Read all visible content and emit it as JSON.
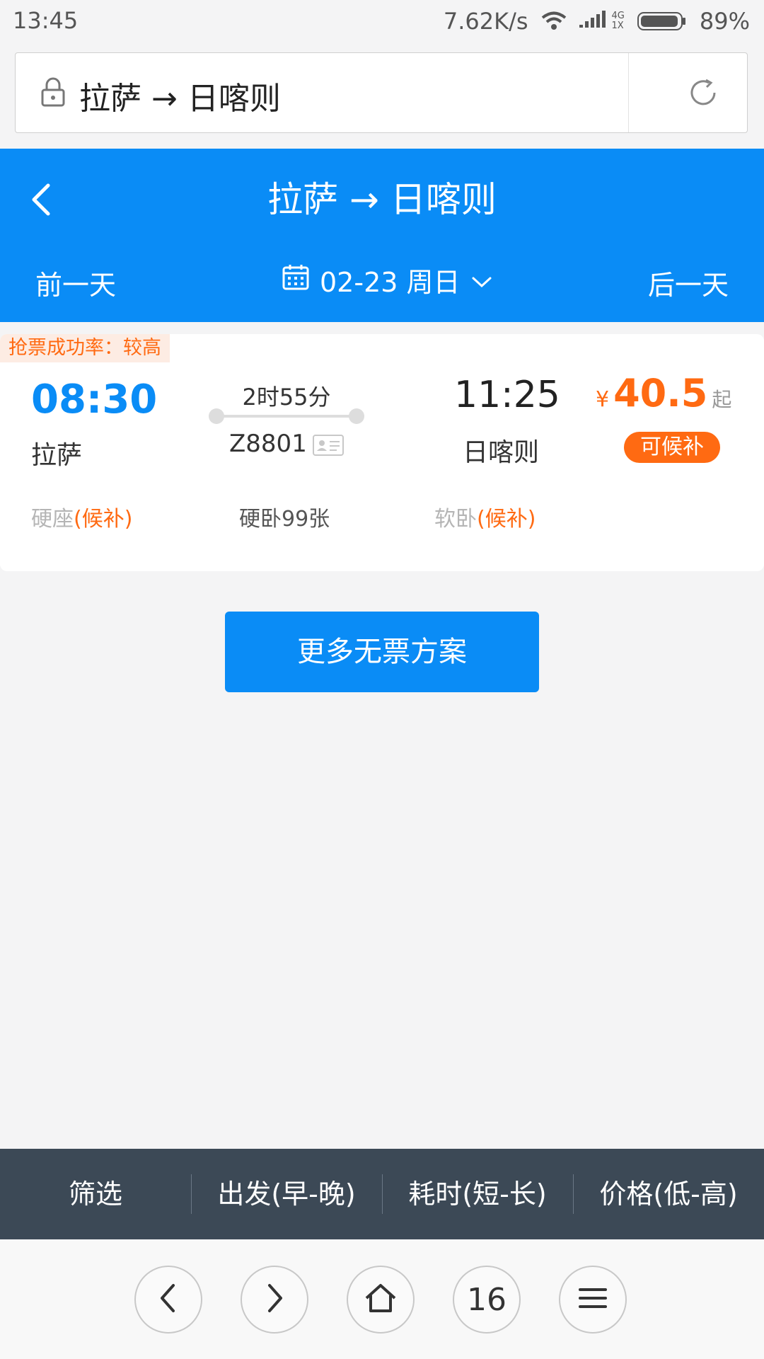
{
  "status_bar": {
    "time": "13:45",
    "net_speed": "7.62K/s",
    "net_type_top": "4G",
    "net_type_bottom": "1X",
    "battery": "89%"
  },
  "address_bar": {
    "text": "拉萨 → 日喀则",
    "icons": [
      "lock-icon",
      "reload-icon"
    ]
  },
  "header": {
    "title": "拉萨 → 日喀则",
    "prev_day": "前一天",
    "next_day": "后一天",
    "date": "02-23 周日",
    "color": "#0a8cf6"
  },
  "train": {
    "badge": "抢票成功率：较高",
    "departure_time": "08:30",
    "departure_station": "拉萨",
    "duration": "2时55分",
    "train_number": "Z8801",
    "arrival_time": "11:25",
    "arrival_station": "日喀则",
    "price_currency": "¥",
    "price_value": "40.5",
    "price_suffix": "起",
    "waitlist_label": "可候补",
    "seats": [
      {
        "type": "硬座",
        "status": "(候补)"
      },
      {
        "type": "硬卧99张",
        "status": ""
      },
      {
        "type": "软卧",
        "status": "(候补)"
      }
    ],
    "accent_color": "#ff6a12"
  },
  "more_button": {
    "label": "更多无票方案"
  },
  "sort_bar": {
    "items": [
      "筛选",
      "出发(早-晚)",
      "耗时(短-长)",
      "价格(低-高)"
    ]
  },
  "browser_nav": {
    "tab_count": "16"
  }
}
